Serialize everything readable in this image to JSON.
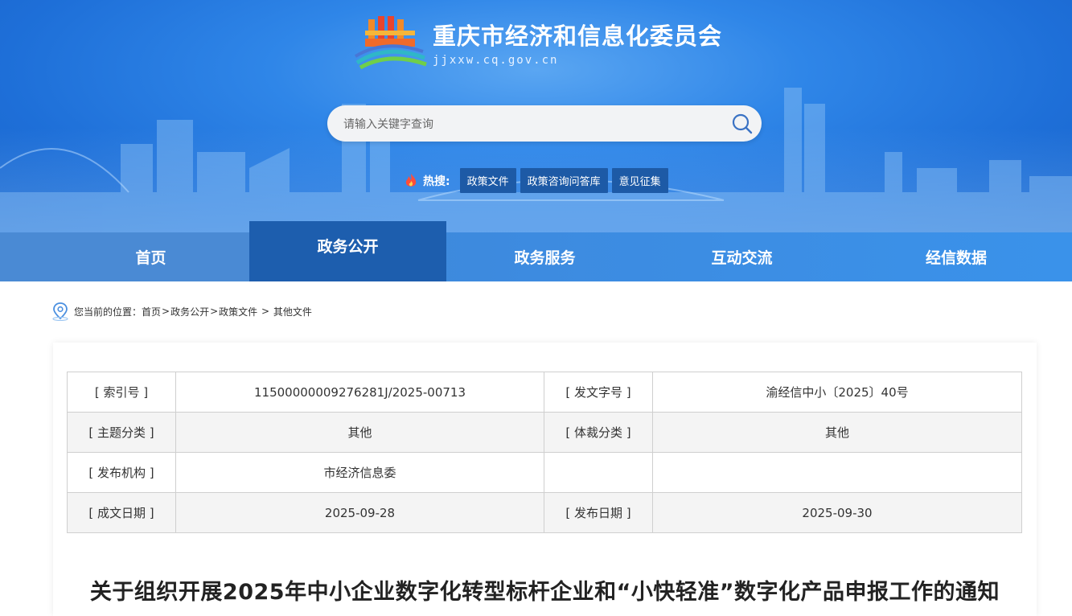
{
  "site": {
    "title": "重庆市经济和信息化委员会",
    "domain": "jjxxw.cq.gov.cn"
  },
  "search": {
    "placeholder": "请输入关键字查询"
  },
  "hot_search": {
    "label": "热搜:",
    "items": [
      "政策文件",
      "政策咨询问答库",
      "意见征集"
    ]
  },
  "nav": {
    "items": [
      "首页",
      "政务公开",
      "政务服务",
      "互动交流",
      "经信数据"
    ],
    "active": "政务公开"
  },
  "breadcrumb": {
    "prefix": "您当前的位置：",
    "items": [
      "首页",
      "政务公开",
      "政策文件",
      "其他文件"
    ],
    "separators": [
      ">",
      ">",
      " > "
    ]
  },
  "meta_table": {
    "rows": [
      {
        "k1": "[ 索引号 ]",
        "v1": "11500000009276281J/2025-00713",
        "k2": "[ 发文字号 ]",
        "v2": "渝经信中小〔2025〕40号"
      },
      {
        "k1": "[ 主题分类 ]",
        "v1": "其他",
        "k2": "[ 体裁分类 ]",
        "v2": "其他"
      },
      {
        "k1": "[ 发布机构 ]",
        "v1": "市经济信息委",
        "k2": "",
        "v2": ""
      },
      {
        "k1": "[ 成文日期 ]",
        "v1": "2025-09-28",
        "k2": "[ 发布日期 ]",
        "v2": "2025-09-30"
      }
    ]
  },
  "document": {
    "title": "关于组织开展2025年中小企业数字化转型标杆企业和“小快轻准”数字化产品申报工作的通知"
  },
  "colors": {
    "banner": "#2f86e8",
    "nav_active": "#1d5eae",
    "chip": "#1d5aa6"
  }
}
